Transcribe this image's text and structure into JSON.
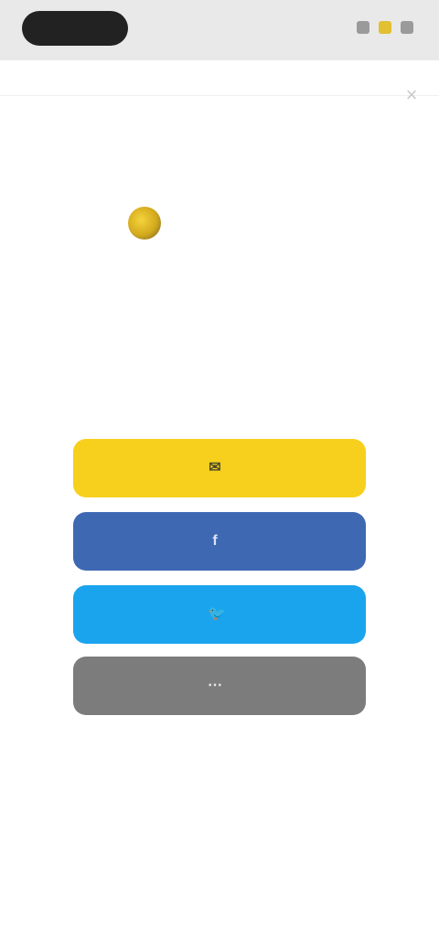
{
  "status_bar": {
    "icons": [
      "signal-icon",
      "wifi-icon",
      "battery-icon"
    ]
  },
  "header": {
    "close_icon": "close-icon"
  },
  "brand": {
    "name": "",
    "logo_icon": "brand-logo-icon",
    "accent": "#F6D01D"
  },
  "intro": {
    "title": "",
    "subtitle": ""
  },
  "buttons": {
    "email": {
      "label": "",
      "color": "#F6D01D",
      "icon": "mail-icon"
    },
    "facebook": {
      "label": "",
      "color": "#3F68B3",
      "icon": "facebook-icon"
    },
    "twitter": {
      "label": "",
      "color": "#1AA4EE",
      "icon": "twitter-icon"
    },
    "other": {
      "label": "",
      "color": "#7C7C7C",
      "icon": "more-icon"
    }
  },
  "footer": {
    "link": ""
  }
}
